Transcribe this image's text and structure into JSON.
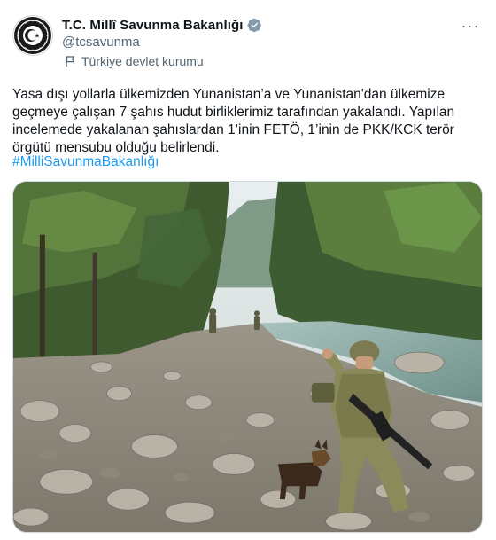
{
  "account": {
    "display_name": "T.C. Millî Savunma Bakanlığı",
    "handle": "@tcsavunma",
    "label": "Türkiye devlet kurumu",
    "verified_color": "#829aab",
    "avatar_icon": "ministry-emblem-icon"
  },
  "tweet": {
    "text": "Yasa dışı yollarla ülkemizden Yunanistan’a ve Yunanistan'dan ülkemize geçmeye çalışan 7 şahıs hudut birliklerimiz tarafından yakalandı. Yapılan incelemede yakalanan şahıslardan 1’inin FETÖ, 1’inin de PKK/KCK terör örgütü mensubu olduğu belirlendi.",
    "hashtag": "#MilliSavunmaBakanlığı",
    "hashtag_color": "#1d9bf0"
  },
  "menu": {
    "more_label": "···"
  },
  "media": {
    "description_icon": "photo"
  }
}
